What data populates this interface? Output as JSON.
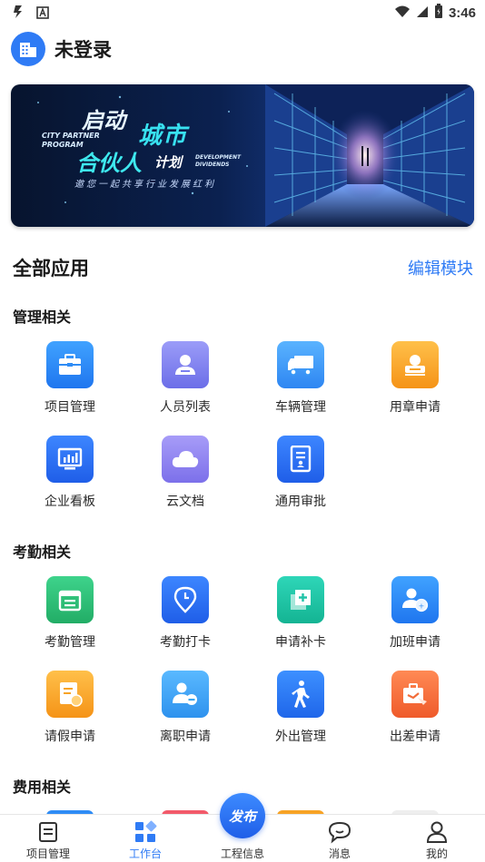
{
  "status_bar": {
    "time": "3:46"
  },
  "header": {
    "title": "未登录",
    "logo_icon": "building-icon"
  },
  "banner": {
    "line1": "启动",
    "city": "城市",
    "en1": "CITY PARTNER\nPROGRAM",
    "line2": "合伙人",
    "line2b": "计划",
    "en2": "DEVELOPMENT\nDIVIDENDS",
    "sub": "邀您一起共享行业发展红利"
  },
  "apps_section": {
    "title": "全部应用",
    "edit_label": "编辑模块"
  },
  "groups": [
    {
      "title": "管理相关",
      "apps": [
        {
          "label": "项目管理",
          "icon": "briefcase-icon",
          "color": "#2f8cf5"
        },
        {
          "label": "人员列表",
          "icon": "person-icon",
          "color": "#7b7ff0"
        },
        {
          "label": "车辆管理",
          "icon": "truck-icon",
          "color": "#3a9af7"
        },
        {
          "label": "用章申请",
          "icon": "stamp-icon",
          "color": "#f7a325"
        },
        {
          "label": "企业看板",
          "icon": "dashboard-icon",
          "color": "#2b6ef2"
        },
        {
          "label": "云文档",
          "icon": "cloud-icon",
          "color": "#8f86f2"
        },
        {
          "label": "通用审批",
          "icon": "document-icon",
          "color": "#2b6ef2"
        }
      ]
    },
    {
      "title": "考勤相关",
      "apps": [
        {
          "label": "考勤管理",
          "icon": "calendar-icon",
          "color": "#2fc07a"
        },
        {
          "label": "考勤打卡",
          "icon": "location-icon",
          "color": "#2b6ef2"
        },
        {
          "label": "申请补卡",
          "icon": "card-add-icon",
          "color": "#21c3a8"
        },
        {
          "label": "加班申请",
          "icon": "overtime-icon",
          "color": "#2f8cf5"
        },
        {
          "label": "请假申请",
          "icon": "leave-icon",
          "color": "#f7a325"
        },
        {
          "label": "离职申请",
          "icon": "resign-icon",
          "color": "#3aa6f2"
        },
        {
          "label": "外出管理",
          "icon": "walking-icon",
          "color": "#2b78f0"
        },
        {
          "label": "出差申请",
          "icon": "travel-icon",
          "color": "#f26d3a"
        }
      ]
    },
    {
      "title": "费用相关",
      "apps": []
    }
  ],
  "bottom_nav": {
    "items": [
      {
        "label": "项目管理",
        "icon": "list-icon"
      },
      {
        "label": "工作台",
        "icon": "grid-icon"
      },
      {
        "label": "工程信息",
        "icon": "publish-icon"
      },
      {
        "label": "消息",
        "icon": "chat-icon"
      },
      {
        "label": "我的",
        "icon": "user-icon"
      }
    ],
    "active_index": 1,
    "publish_label": "发布"
  },
  "colors": {
    "accent": "#2f7bf5"
  }
}
